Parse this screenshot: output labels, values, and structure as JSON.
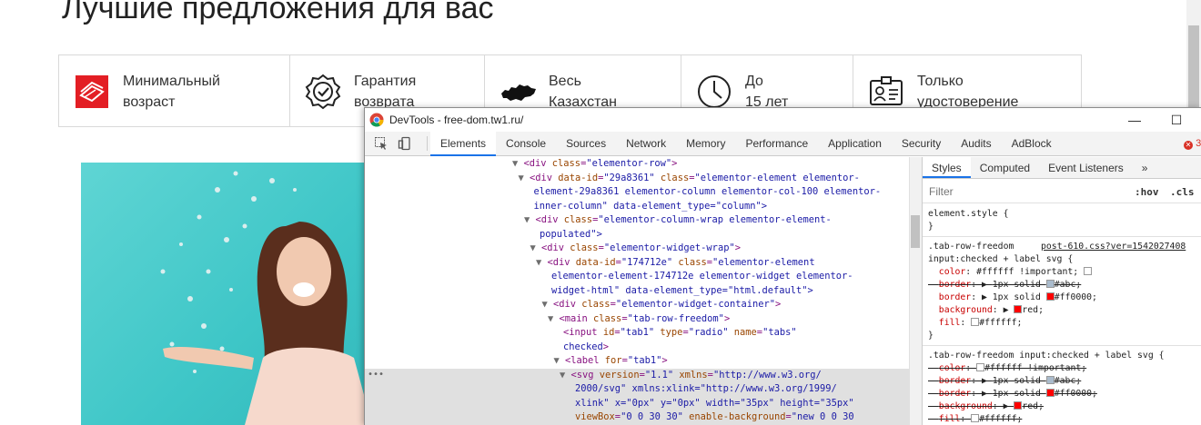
{
  "site": {
    "title": "Лучшие предложения для вас",
    "features": [
      {
        "line1": "Минимальный",
        "line2": "возраст",
        "icon": "age-badge-icon"
      },
      {
        "line1": "Гарантия",
        "line2": "возврата",
        "icon": "guarantee-check-icon"
      },
      {
        "line1": "Весь",
        "line2": "Казахстан",
        "icon": "kazakhstan-map-icon"
      },
      {
        "line1": "До",
        "line2": "15 лет",
        "icon": "clock-icon"
      },
      {
        "line1": "Только",
        "line2": "удостоверение",
        "icon": "id-card-icon"
      }
    ],
    "colors": {
      "accent": "#e31e24",
      "hero_bg": "#3ec6c7"
    }
  },
  "devtools": {
    "window_title": "DevTools - free-dom.tw1.ru/",
    "minimize": "—",
    "maximize": "☐",
    "tabs": [
      "Elements",
      "Console",
      "Sources",
      "Network",
      "Memory",
      "Performance",
      "Application",
      "Security",
      "Audits",
      "AdBlock"
    ],
    "active_tab": "Elements",
    "error_count": "3",
    "elements": [
      {
        "indent": 21,
        "tri": "▼",
        "text": "<div class=\"elementor-row\">"
      },
      {
        "indent": 22,
        "tri": "▼",
        "text": "<div data-id=\"29a8361\" class=\"elementor-element elementor-"
      },
      {
        "indent": 23,
        "tri": "",
        "text": "element-29a8361 elementor-column elementor-col-100 elementor-"
      },
      {
        "indent": 23,
        "tri": "",
        "text": "inner-column\" data-element_type=\"column\">"
      },
      {
        "indent": 23,
        "tri": "▼",
        "text": "<div class=\"elementor-column-wrap elementor-element-"
      },
      {
        "indent": 24,
        "tri": "",
        "text": "populated\">"
      },
      {
        "indent": 24,
        "tri": "▼",
        "text": "<div class=\"elementor-widget-wrap\">"
      },
      {
        "indent": 25,
        "tri": "▼",
        "text": "<div data-id=\"174712e\" class=\"elementor-element"
      },
      {
        "indent": 26,
        "tri": "",
        "text": "elementor-element-174712e elementor-widget elementor-"
      },
      {
        "indent": 26,
        "tri": "",
        "text": "widget-html\" data-element_type=\"html.default\">"
      },
      {
        "indent": 26,
        "tri": "▼",
        "text": "<div class=\"elementor-widget-container\">"
      },
      {
        "indent": 27,
        "tri": "▼",
        "text": "<main class=\"tab-row-freedom\">"
      },
      {
        "indent": 28,
        "tri": "",
        "text": "<input id=\"tab1\" type=\"radio\" name=\"tabs\""
      },
      {
        "indent": 28,
        "tri": "",
        "text": "checked>"
      },
      {
        "indent": 28,
        "tri": "▼",
        "text": "<label for=\"tab1\">"
      },
      {
        "indent": 29,
        "tri": "▼",
        "text": "<svg version=\"1.1\" xmlns=\"http://www.w3.org/",
        "highlight": true
      },
      {
        "indent": 30,
        "tri": "",
        "text": "2000/svg\" xmlns:xlink=\"http://www.w3.org/1999/",
        "highlight": true
      },
      {
        "indent": 30,
        "tri": "",
        "text": "xlink\" x=\"0px\" y=\"0px\" width=\"35px\" height=\"35px\"",
        "highlight": true
      },
      {
        "indent": 30,
        "tri": "",
        "text": "viewBox=\"0 0 30 30\" enable-background=\"new 0 0 30",
        "highlight": true
      }
    ],
    "styles": {
      "tabs": [
        "Styles",
        "Computed",
        "Event Listeners",
        "»"
      ],
      "active_tab": "Styles",
      "filter_placeholder": "Filter",
      "hov": ":hov",
      "cls": ".cls",
      "element_style": "element.style {",
      "close_brace": "}",
      "rule1_selector_a": ".tab-row-freedom",
      "rule1_source": "post-610.css?ver=1542027408",
      "rule1_selector_b": "input:checked + label svg {",
      "rule1_props": [
        {
          "name": "color",
          "value": "#ffffff !important;",
          "swatch": "#ffffff",
          "strike": false,
          "expand": false
        },
        {
          "name": "border",
          "value": "1px solid",
          "value2": "#abc;",
          "swatch": "#aabbcc",
          "strike": true,
          "expand": true
        },
        {
          "name": "border",
          "value": "1px solid",
          "value2": "#ff0000;",
          "swatch": "#ff0000",
          "strike": false,
          "expand": true
        },
        {
          "name": "background",
          "value": "",
          "value2": "red;",
          "swatch": "#ff0000",
          "strike": false,
          "expand": true
        },
        {
          "name": "fill",
          "value": "",
          "value2": "#ffffff;",
          "swatch": "#ffffff",
          "strike": false,
          "expand": false
        }
      ],
      "rule2_selector": ".tab-row-freedom input:checked + label svg {",
      "rule2_props": [
        {
          "name": "color",
          "value": "",
          "value2": "#ffffff !important;",
          "swatch": "#ffffff",
          "strike": true,
          "expand": false
        },
        {
          "name": "border",
          "value": "1px solid",
          "value2": "#abc;",
          "swatch": "#aabbcc",
          "strike": true,
          "expand": true
        },
        {
          "name": "border",
          "value": "1px solid",
          "value2": "#ff0000;",
          "swatch": "#ff0000",
          "strike": true,
          "expand": true
        },
        {
          "name": "background",
          "value": "",
          "value2": "red;",
          "swatch": "#ff0000",
          "strike": true,
          "expand": true
        },
        {
          "name": "fill",
          "value": "",
          "value2": "#ffffff;",
          "swatch": "#ffffff",
          "strike": true,
          "expand": false
        }
      ]
    }
  }
}
